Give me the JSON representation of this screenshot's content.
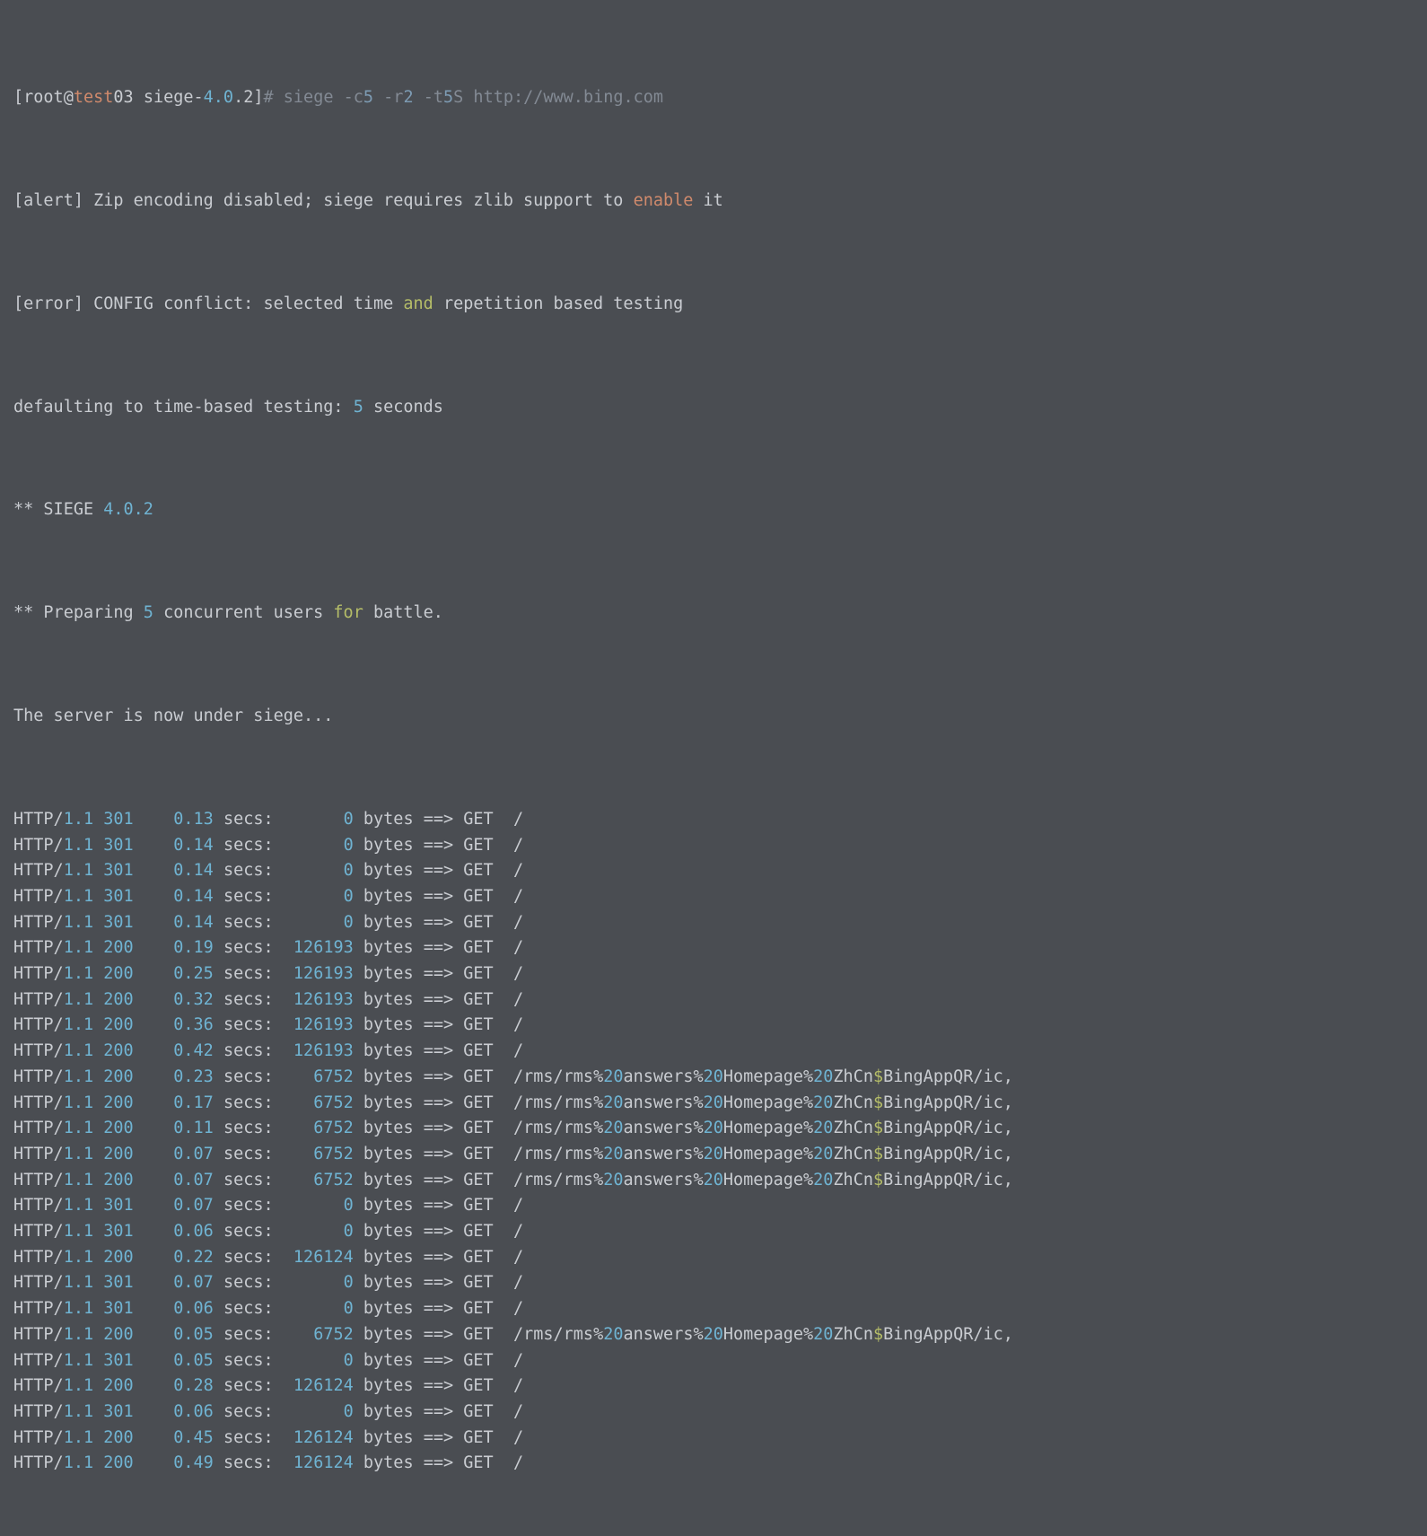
{
  "prompt": {
    "open": "[",
    "user": "root",
    "at": "@",
    "host": "test",
    "hostnum": "03",
    "space": " ",
    "dir_pre": "siege-",
    "dir_ver": "4.0",
    "dir_ver2": ".2",
    "close": "]",
    "hash": "# ",
    "cmd": "siege -c",
    "c": "5",
    "r_pre": " -r",
    "r": "2",
    "t_pre": " -t",
    "t": "5",
    "url": "S http://www.bing.com"
  },
  "alert": {
    "l": "[alert] Zip encoding disabled; siege requires zlib support to ",
    "enable": "enable",
    "r": " it"
  },
  "err": {
    "l": "[error] CONFIG conflict: selected time ",
    "and": "and",
    "r": " repetition based testing"
  },
  "def": {
    "l": "defaulting to time-based testing: ",
    "n": "5",
    "r": " seconds"
  },
  "siege": {
    "l": "** SIEGE ",
    "v": "4.0.2"
  },
  "prep": {
    "a": "** Preparing ",
    "n": "5",
    "b": " concurrent users ",
    "for": "for",
    "c": " battle."
  },
  "under": "The server is now under siege...",
  "url_long": "/rms/rms%20answers%20Homepage%20ZhCn$BingAppQR/ic,",
  "rows": [
    {
      "ver": "1.1",
      "code": "301",
      "secs": "0.13",
      "bytes": "0",
      "path": "/"
    },
    {
      "ver": "1.1",
      "code": "301",
      "secs": "0.14",
      "bytes": "0",
      "path": "/"
    },
    {
      "ver": "1.1",
      "code": "301",
      "secs": "0.14",
      "bytes": "0",
      "path": "/"
    },
    {
      "ver": "1.1",
      "code": "301",
      "secs": "0.14",
      "bytes": "0",
      "path": "/"
    },
    {
      "ver": "1.1",
      "code": "301",
      "secs": "0.14",
      "bytes": "0",
      "path": "/"
    },
    {
      "ver": "1.1",
      "code": "200",
      "secs": "0.19",
      "bytes": "126193",
      "path": "/"
    },
    {
      "ver": "1.1",
      "code": "200",
      "secs": "0.25",
      "bytes": "126193",
      "path": "/"
    },
    {
      "ver": "1.1",
      "code": "200",
      "secs": "0.32",
      "bytes": "126193",
      "path": "/"
    },
    {
      "ver": "1.1",
      "code": "200",
      "secs": "0.36",
      "bytes": "126193",
      "path": "/"
    },
    {
      "ver": "1.1",
      "code": "200",
      "secs": "0.42",
      "bytes": "126193",
      "path": "/"
    },
    {
      "ver": "1.1",
      "code": "200",
      "secs": "0.23",
      "bytes": "6752",
      "path": "LONG"
    },
    {
      "ver": "1.1",
      "code": "200",
      "secs": "0.17",
      "bytes": "6752",
      "path": "LONG"
    },
    {
      "ver": "1.1",
      "code": "200",
      "secs": "0.11",
      "bytes": "6752",
      "path": "LONG"
    },
    {
      "ver": "1.1",
      "code": "200",
      "secs": "0.07",
      "bytes": "6752",
      "path": "LONG"
    },
    {
      "ver": "1.1",
      "code": "200",
      "secs": "0.07",
      "bytes": "6752",
      "path": "LONG"
    },
    {
      "ver": "1.1",
      "code": "301",
      "secs": "0.07",
      "bytes": "0",
      "path": "/"
    },
    {
      "ver": "1.1",
      "code": "301",
      "secs": "0.06",
      "bytes": "0",
      "path": "/"
    },
    {
      "ver": "1.1",
      "code": "200",
      "secs": "0.22",
      "bytes": "126124",
      "path": "/"
    },
    {
      "ver": "1.1",
      "code": "301",
      "secs": "0.07",
      "bytes": "0",
      "path": "/"
    },
    {
      "ver": "1.1",
      "code": "301",
      "secs": "0.06",
      "bytes": "0",
      "path": "/"
    },
    {
      "ver": "1.1",
      "code": "200",
      "secs": "0.05",
      "bytes": "6752",
      "path": "LONG"
    },
    {
      "ver": "1.1",
      "code": "301",
      "secs": "0.05",
      "bytes": "0",
      "path": "/"
    },
    {
      "ver": "1.1",
      "code": "200",
      "secs": "0.28",
      "bytes": "126124",
      "path": "/"
    },
    {
      "ver": "1.1",
      "code": "301",
      "secs": "0.06",
      "bytes": "0",
      "path": "/"
    },
    {
      "ver": "1.1",
      "code": "200",
      "secs": "0.45",
      "bytes": "126124",
      "path": "/"
    },
    {
      "ver": "1.1",
      "code": "200",
      "secs": "0.49",
      "bytes": "126124",
      "path": "/"
    }
  ]
}
